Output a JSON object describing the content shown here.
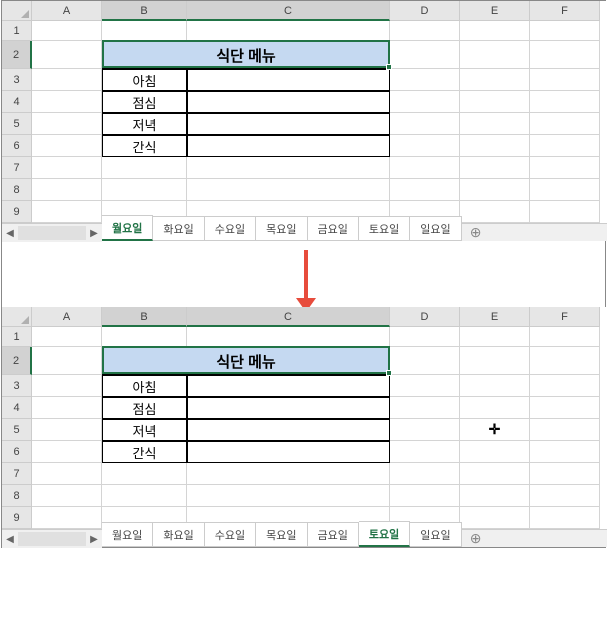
{
  "columns": [
    "A",
    "B",
    "C",
    "D",
    "E",
    "F"
  ],
  "rows": [
    "1",
    "2",
    "3",
    "4",
    "5",
    "6",
    "7",
    "8",
    "9"
  ],
  "table": {
    "title": "식단 메뉴",
    "labels": [
      "아침",
      "점심",
      "저녁",
      "간식"
    ]
  },
  "cursor": "✛",
  "tabs": {
    "items": [
      "월요일",
      "화요일",
      "수요일",
      "목요일",
      "금요일",
      "토요일",
      "일요일"
    ],
    "active_top": "월요일",
    "active_bottom": "토요일",
    "new_tab": "⊕"
  }
}
